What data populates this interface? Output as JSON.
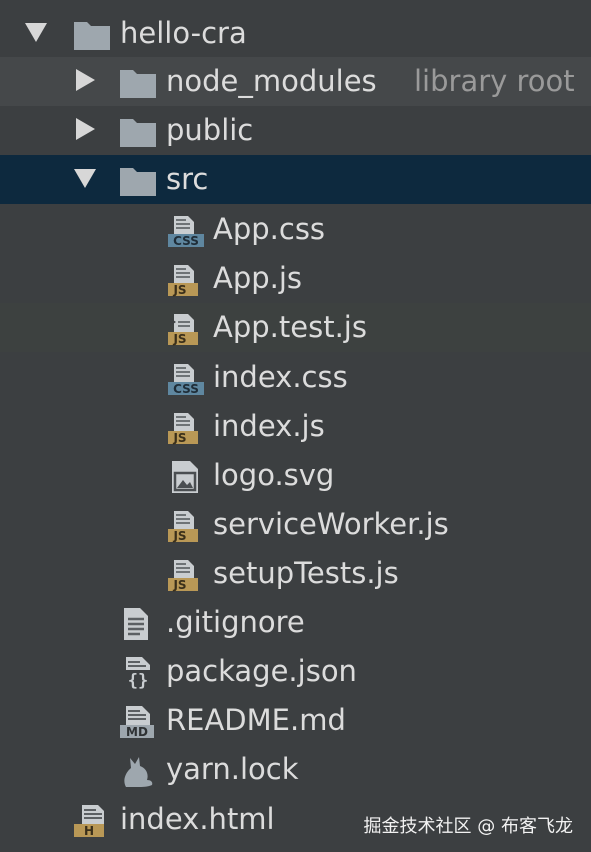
{
  "project_tree": {
    "root": {
      "label": "hello-cra",
      "icon": "folder-icon",
      "expanded": true
    },
    "items": [
      {
        "label": "node_modules",
        "suffix": "library root",
        "icon": "folder-icon",
        "expanded": false
      },
      {
        "label": "public",
        "icon": "folder-icon",
        "expanded": false
      },
      {
        "label": "src",
        "icon": "folder-icon",
        "expanded": true,
        "selected": true
      },
      {
        "label": "App.css",
        "icon": "css-file-icon",
        "badge": "CSS"
      },
      {
        "label": "App.js",
        "icon": "js-file-icon",
        "badge": "JS"
      },
      {
        "label": "App.test.js",
        "icon": "js-test-file-icon",
        "badge": "JS"
      },
      {
        "label": "index.css",
        "icon": "css-file-icon",
        "badge": "CSS"
      },
      {
        "label": "index.js",
        "icon": "js-file-icon",
        "badge": "JS"
      },
      {
        "label": "logo.svg",
        "icon": "image-file-icon"
      },
      {
        "label": "serviceWorker.js",
        "icon": "js-file-icon",
        "badge": "JS"
      },
      {
        "label": "setupTests.js",
        "icon": "js-file-icon",
        "badge": "JS"
      },
      {
        "label": ".gitignore",
        "icon": "text-file-icon"
      },
      {
        "label": "package.json",
        "icon": "json-file-icon"
      },
      {
        "label": "README.md",
        "icon": "markdown-file-icon",
        "badge": "MD"
      },
      {
        "label": "yarn.lock",
        "icon": "yarn-icon"
      },
      {
        "label": "index.html",
        "icon": "html-file-icon",
        "badge": "H"
      }
    ]
  },
  "colors": {
    "background": "#3c3f41",
    "selected_row": "#0d293e",
    "text": "#dcdcdc",
    "folder": "#9ea7ae",
    "js_badge": "#b99856",
    "css_badge": "#5f87a0"
  },
  "watermark": "掘金技术社区 @ 布客飞龙"
}
